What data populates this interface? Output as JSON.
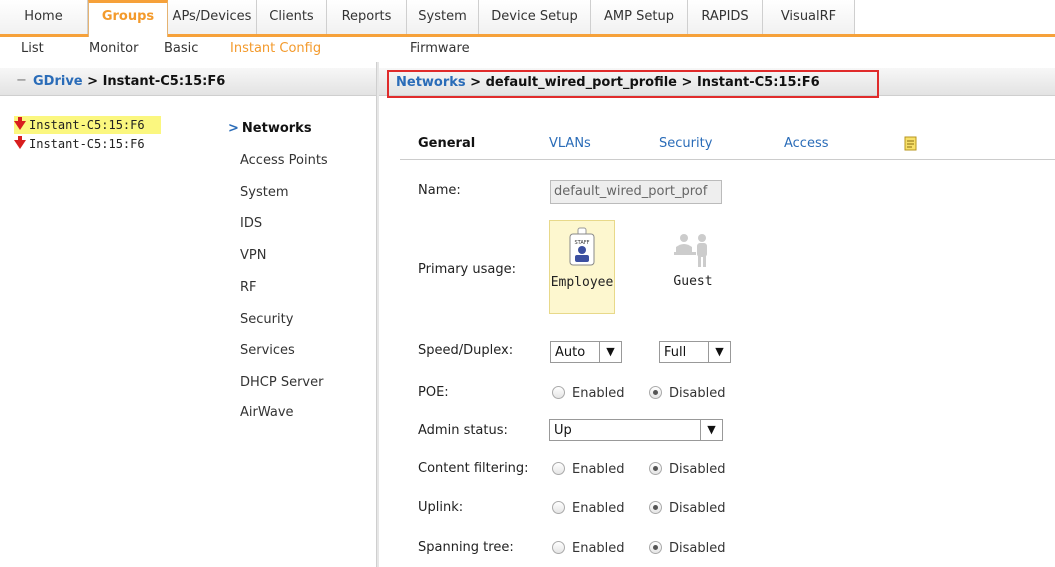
{
  "top_tabs": [
    "Home",
    "Groups",
    "APs/Devices",
    "Clients",
    "Reports",
    "System",
    "Device Setup",
    "AMP Setup",
    "RAPIDS",
    "VisualRF"
  ],
  "sub_tabs": [
    "List",
    "Monitor",
    "Basic",
    "Instant Config",
    "Firmware"
  ],
  "left_header": {
    "collapse": "−",
    "link": "GDrive",
    "sep": " > ",
    "current": "Instant-C5:15:F6"
  },
  "breadcrumb": {
    "link": "Networks",
    "rest": " > default_wired_port_profile > Instant-C5:15:F6"
  },
  "tree": [
    "Instant-C5:15:F6",
    "Instant-C5:15:F6"
  ],
  "menu": {
    "chevron": ">",
    "items": [
      "Networks",
      "Access Points",
      "System",
      "IDS",
      "VPN",
      "RF",
      "Security",
      "Services",
      "DHCP Server",
      "AirWave"
    ]
  },
  "content_tabs": [
    "General",
    "VLANs",
    "Security",
    "Access"
  ],
  "form": {
    "name_label": "Name:",
    "name_value": "default_wired_port_prof",
    "usage_label": "Primary usage:",
    "usage_options": [
      "Employee",
      "Guest"
    ],
    "usage_badge": "STAFF",
    "speed_label": "Speed/Duplex:",
    "speed_value": "Auto",
    "duplex_value": "Full",
    "poe_label": "POE:",
    "admin_label": "Admin status:",
    "admin_value": "Up",
    "content_filtering_label": "Content filtering:",
    "uplink_label": "Uplink:",
    "spanning_label": "Spanning tree:",
    "enabled": "Enabled",
    "disabled": "Disabled"
  },
  "dropdown_glyph": "▼",
  "colors": {
    "accent": "#f39a2c",
    "link": "#2a6cb8",
    "highlight": "#e02b2b",
    "tree_selected": "#fbf77f"
  }
}
